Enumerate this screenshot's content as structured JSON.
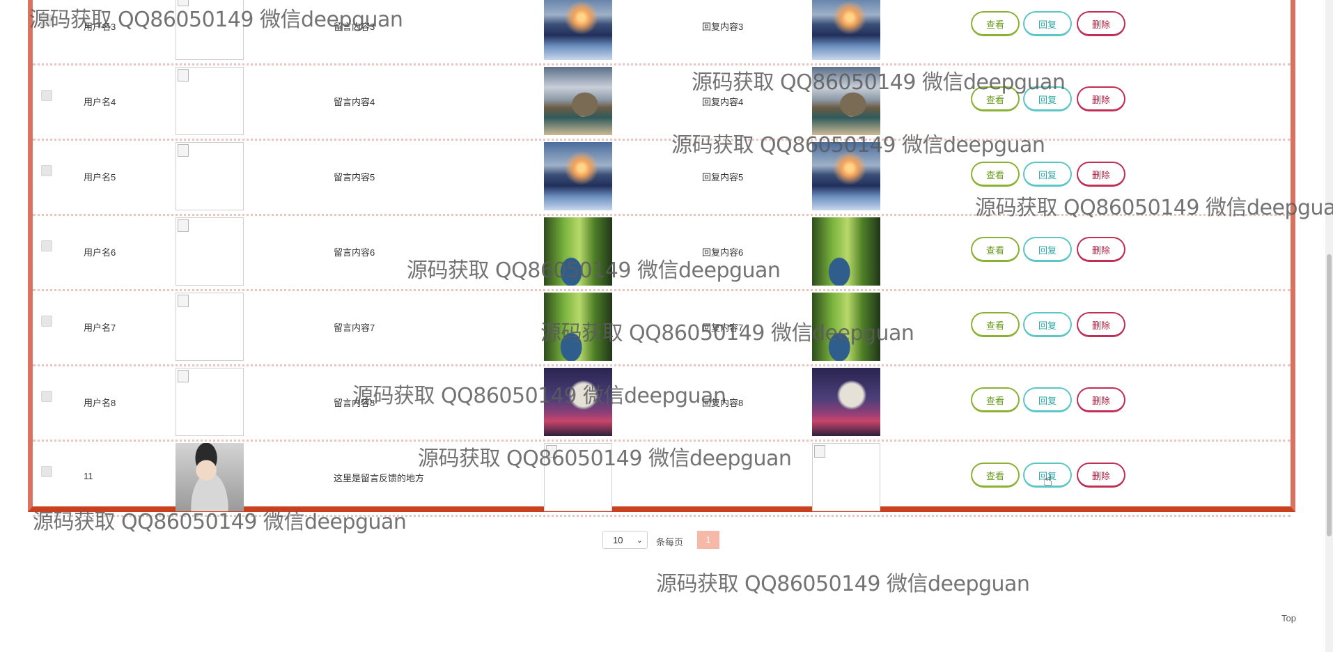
{
  "table": {
    "rows": [
      {
        "user": "用户名3",
        "message": "留言内容3",
        "reply": "回复内容3",
        "avatar": "broken",
        "msgimg": "mountain",
        "replyimg": "mountain"
      },
      {
        "user": "用户名4",
        "message": "留言内容4",
        "reply": "回复内容4",
        "avatar": "broken",
        "msgimg": "arch",
        "replyimg": "arch"
      },
      {
        "user": "用户名5",
        "message": "留言内容5",
        "reply": "回复内容5",
        "avatar": "broken",
        "msgimg": "mountain",
        "replyimg": "mountain"
      },
      {
        "user": "用户名6",
        "message": "留言内容6",
        "reply": "回复内容6",
        "avatar": "broken",
        "msgimg": "forest",
        "replyimg": "forest"
      },
      {
        "user": "用户名7",
        "message": "留言内容7",
        "reply": "回复内容7",
        "avatar": "broken",
        "msgimg": "forest",
        "replyimg": "forest"
      },
      {
        "user": "用户名8",
        "message": "留言内容8",
        "reply": "回复内容8",
        "avatar": "broken",
        "msgimg": "moon",
        "replyimg": "moon"
      },
      {
        "user": "11",
        "message": "这里是留言反馈的地方",
        "reply": "",
        "avatar": "avatar",
        "msgimg": "broken",
        "replyimg": "broken"
      }
    ],
    "actions": {
      "view": "查看",
      "reply": "回复",
      "delete": "删除"
    }
  },
  "pagination": {
    "page_size_selected": "10",
    "per_page_label": "条每页",
    "current_page": "1"
  },
  "top_link": "Top",
  "watermark": "源码获取 QQ86050149 微信deepguan",
  "colors": {
    "border": "#d9735f",
    "view": "#8ab034",
    "reply": "#5cc6c7",
    "delete": "#c02d55",
    "page_active": "#f6b9a8"
  }
}
